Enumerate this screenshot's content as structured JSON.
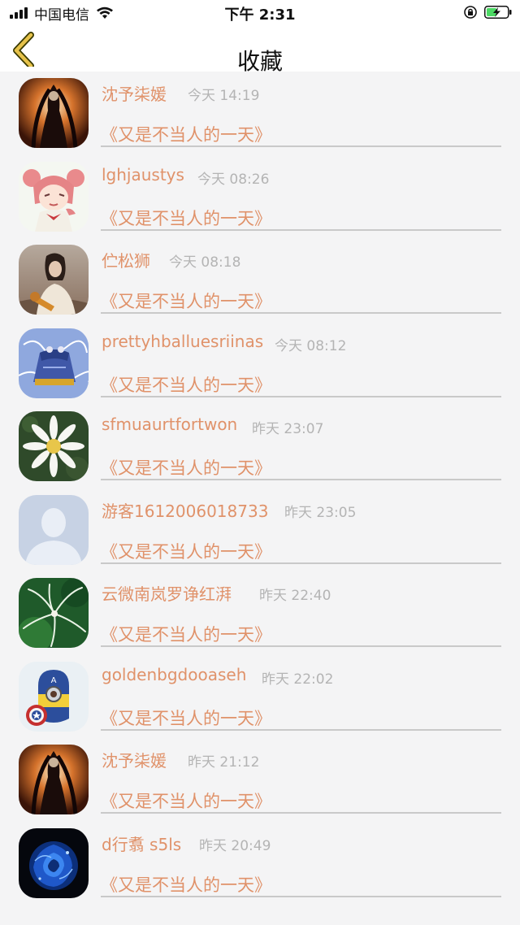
{
  "status_bar": {
    "carrier": "中国电信",
    "time": "下午 2:31"
  },
  "header": {
    "title": "收藏"
  },
  "items": [
    {
      "name": "沈予柒媛",
      "time": "今天 14:19",
      "title": "《又是不当人的一天》",
      "avatar": "dark-figure-avatar"
    },
    {
      "name": "lghjaustys",
      "time": "今天 08:26",
      "title": "《又是不当人的一天》",
      "avatar": "anime-girl-avatar"
    },
    {
      "name": "伫松狮",
      "time": "今天 08:18",
      "title": "《又是不当人的一天》",
      "avatar": "girl-photo-avatar"
    },
    {
      "name": "prettyhballuesriinas",
      "time": "今天 08:12",
      "title": "《又是不当人的一天》",
      "avatar": "blue-drawing-avatar"
    },
    {
      "name": "sfmuaurtfortwon",
      "time": "昨天 23:07",
      "title": "《又是不当人的一天》",
      "avatar": "white-flower-avatar"
    },
    {
      "name": "游客1612006018733",
      "time": "昨天 23:05",
      "title": "《又是不当人的一天》",
      "avatar": "default-person-avatar"
    },
    {
      "name": "云微南岚罗诤红湃",
      "time": "昨天 22:40",
      "title": "《又是不当人的一天》",
      "avatar": "green-plant-avatar"
    },
    {
      "name": "goldenbgdooaseh",
      "time": "昨天 22:02",
      "title": "《又是不当人的一天》",
      "avatar": "minion-captain-avatar"
    },
    {
      "name": "沈予柒媛",
      "time": "昨天 21:12",
      "title": "《又是不当人的一天》",
      "avatar": "dark-figure-avatar"
    },
    {
      "name": "d行翥 s5ls",
      "time": "昨天 20:49",
      "title": "《又是不当人的一天》",
      "avatar": "blue-rose-avatar"
    }
  ],
  "colors": {
    "accent": "#e0926a",
    "time_text": "#b4b4b4",
    "back_arrow": "#e6c24a",
    "background": "#f4f4f5"
  }
}
